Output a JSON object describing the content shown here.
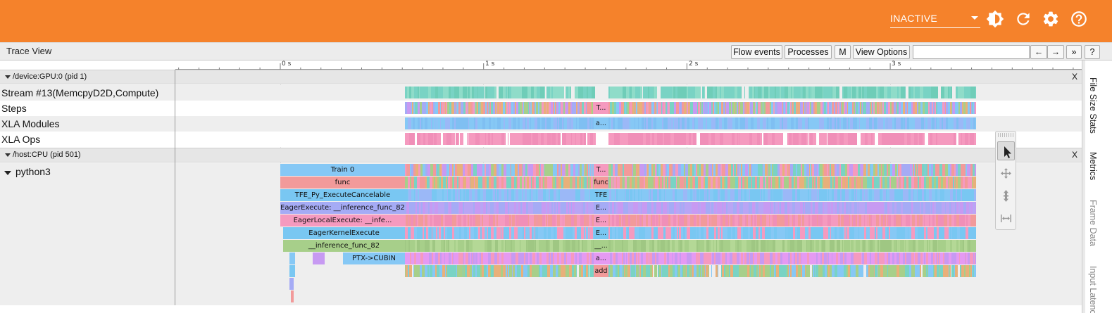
{
  "topbar": {
    "color": "#f5822b",
    "session_select": {
      "value": "INACTIVE"
    },
    "icons": [
      "brightness-icon",
      "refresh-icon",
      "settings-icon",
      "help-icon"
    ]
  },
  "trace_view": {
    "title": "Trace View",
    "buttons": {
      "flow_events": "Flow events",
      "processes": "Processes",
      "metadata": "M",
      "view_options": "View Options",
      "prev": "←",
      "next": "→",
      "expand": "»",
      "help": "?"
    },
    "search": {
      "value": ""
    }
  },
  "ruler": {
    "ticks": [
      "0 s",
      "1 s",
      "2 s",
      "3 s"
    ]
  },
  "processes": [
    {
      "label": "/device:GPU:0 (pid 1)",
      "close": "X",
      "tracks": [
        "Stream #13(MemcpyD2D,Compute)",
        "Steps",
        "XLA Modules",
        "XLA Ops"
      ]
    },
    {
      "label": "/host:CPU (pid 501)",
      "close": "X",
      "tracks": [
        "python3"
      ]
    }
  ],
  "slices": {
    "steps_inline": "T...",
    "modules_inline": "a...",
    "python3": [
      {
        "name": "Train 0",
        "inline": "T..."
      },
      {
        "name": "func",
        "inline": "func"
      },
      {
        "name": "TFE_Py_ExecuteCancelable",
        "inline": "TFE"
      },
      {
        "name": "EagerExecute: __inference_func_82",
        "inline": "E..."
      },
      {
        "name": "EagerLocalExecute: __infe...",
        "inline": "E..."
      },
      {
        "name": "EagerKernelExecute",
        "inline": "E..."
      },
      {
        "name": "__inference_func_82",
        "inline": "__..."
      },
      {
        "name": "PTX->CUBIN",
        "inline": "a..."
      },
      {
        "name": "",
        "inline": "add"
      }
    ]
  },
  "mouse_modes": [
    "selection-mode-icon",
    "pan-mode-icon",
    "zoom-mode-icon",
    "timing-mode-icon"
  ],
  "side_tabs": [
    "File Size Stats",
    "Metrics",
    "Frame Data",
    "Input Latency"
  ]
}
